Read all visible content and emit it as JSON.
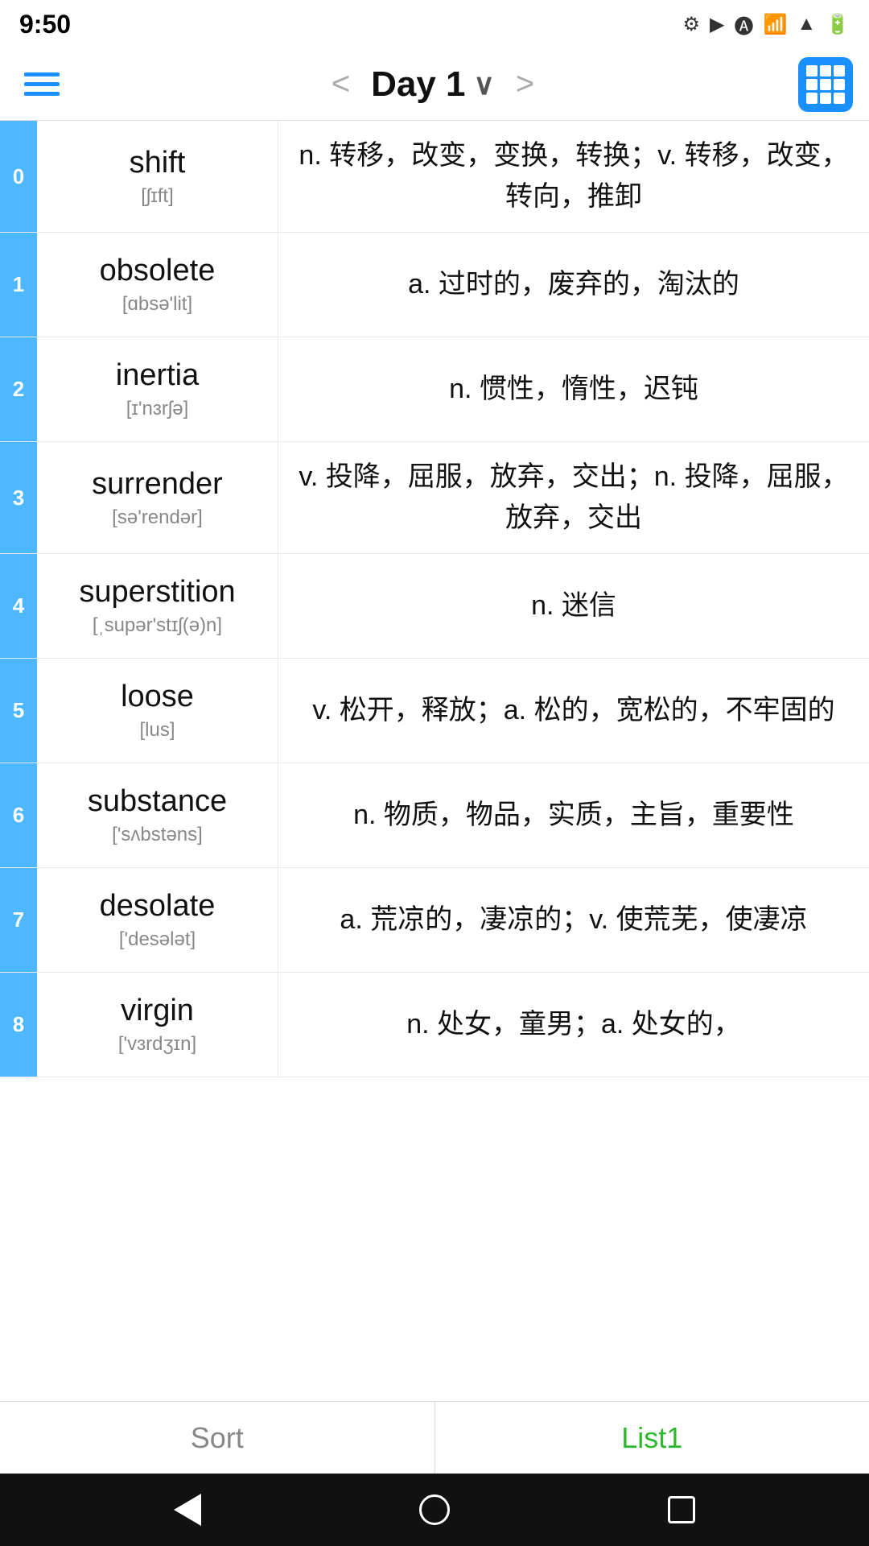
{
  "statusBar": {
    "time": "9:50"
  },
  "nav": {
    "title": "Day 1",
    "prevLabel": "<",
    "nextLabel": ">",
    "menuLabel": "Menu",
    "gridLabel": "Grid View"
  },
  "words": [
    {
      "index": "0",
      "english": "shift",
      "phonetic": "[ʃɪft]",
      "definition": "n. 转移，改变，变换，转换；v. 转移，改变，转向，推卸"
    },
    {
      "index": "1",
      "english": "obsolete",
      "phonetic": "[ɑbsə'lit]",
      "definition": "a. 过时的，废弃的，淘汰的"
    },
    {
      "index": "2",
      "english": "inertia",
      "phonetic": "[ɪ'nɜrʃə]",
      "definition": "n. 惯性，惰性，迟钝"
    },
    {
      "index": "3",
      "english": "surrender",
      "phonetic": "[sə'rendər]",
      "definition": "v. 投降，屈服，放弃，交出；n. 投降，屈服，放弃，交出"
    },
    {
      "index": "4",
      "english": "superstition",
      "phonetic": "[ˌsupər'stɪʃ(ə)n]",
      "definition": "n. 迷信"
    },
    {
      "index": "5",
      "english": "loose",
      "phonetic": "[lus]",
      "definition": "v. 松开，释放；a. 松的，宽松的，不牢固的"
    },
    {
      "index": "6",
      "english": "substance",
      "phonetic": "['sʌbstəns]",
      "definition": "n. 物质，物品，实质，主旨，重要性"
    },
    {
      "index": "7",
      "english": "desolate",
      "phonetic": "['desələt]",
      "definition": "a. 荒凉的，凄凉的；v. 使荒芜，使凄凉"
    },
    {
      "index": "8",
      "english": "virgin",
      "phonetic": "['vɜrdʒɪn]",
      "definition": "n. 处女，童男；a. 处女的，"
    }
  ],
  "bottomTabs": {
    "sortLabel": "Sort",
    "list1Label": "List1"
  }
}
